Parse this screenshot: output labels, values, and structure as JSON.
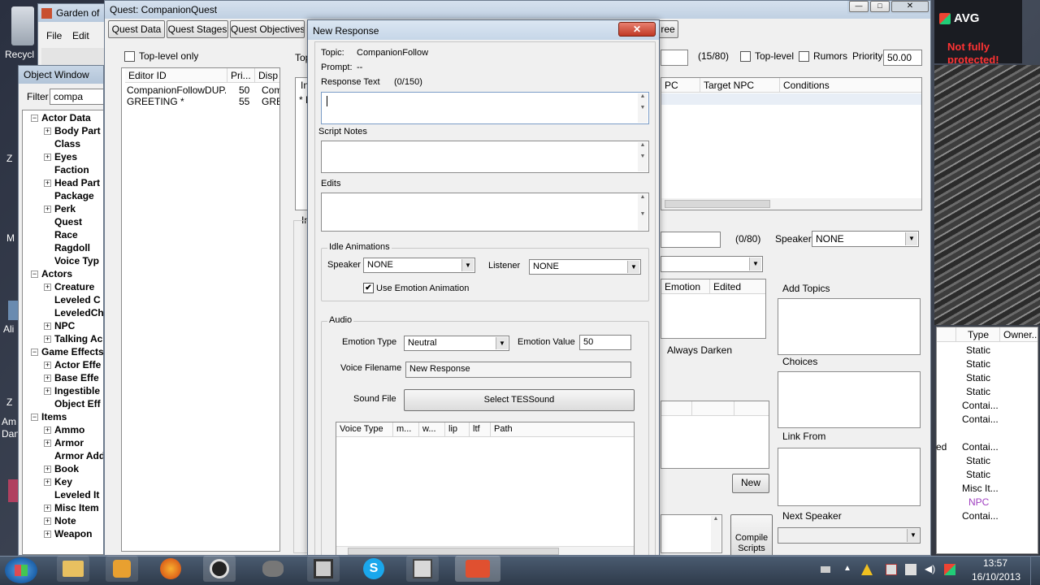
{
  "desktop": {
    "recycle_label": "Recycl",
    "frag1": "Z",
    "frag2": "M",
    "frag3": "Ali",
    "frag4": "Z",
    "frag5": "Am",
    "frag6": "Dan"
  },
  "garden_window": {
    "title": "Garden of",
    "menu_file": "File",
    "menu_edit": "Edit"
  },
  "object_window": {
    "title": "Object Window",
    "filter_label": "Filter",
    "filter_value": "compa",
    "tree": [
      {
        "label": "Actor Data",
        "level": 0,
        "pm": "−"
      },
      {
        "label": "Body Part",
        "level": 1,
        "pm": "+"
      },
      {
        "label": "Class",
        "level": 1,
        "pm": ""
      },
      {
        "label": "Eyes",
        "level": 1,
        "pm": "+"
      },
      {
        "label": "Faction",
        "level": 1,
        "pm": ""
      },
      {
        "label": "Head Part",
        "level": 1,
        "pm": "+"
      },
      {
        "label": "Package",
        "level": 1,
        "pm": ""
      },
      {
        "label": "Perk",
        "level": 1,
        "pm": "+"
      },
      {
        "label": "Quest",
        "level": 1,
        "pm": ""
      },
      {
        "label": "Race",
        "level": 1,
        "pm": ""
      },
      {
        "label": "Ragdoll",
        "level": 1,
        "pm": ""
      },
      {
        "label": "Voice Typ",
        "level": 1,
        "pm": ""
      },
      {
        "label": "Actors",
        "level": 0,
        "pm": "−"
      },
      {
        "label": "Creature",
        "level": 1,
        "pm": "+"
      },
      {
        "label": "Leveled C",
        "level": 1,
        "pm": ""
      },
      {
        "label": "LeveledCh",
        "level": 1,
        "pm": ""
      },
      {
        "label": "NPC",
        "level": 1,
        "pm": "+"
      },
      {
        "label": "Talking Ac",
        "level": 1,
        "pm": "+"
      },
      {
        "label": "Game Effects",
        "level": 0,
        "pm": "−"
      },
      {
        "label": "Actor Effe",
        "level": 1,
        "pm": "+"
      },
      {
        "label": "Base Effe",
        "level": 1,
        "pm": "+"
      },
      {
        "label": "Ingestible",
        "level": 1,
        "pm": "+"
      },
      {
        "label": "Object Eff",
        "level": 1,
        "pm": ""
      },
      {
        "label": "Items",
        "level": 0,
        "pm": "−"
      },
      {
        "label": "Ammo",
        "level": 1,
        "pm": "+"
      },
      {
        "label": "Armor",
        "level": 1,
        "pm": "+"
      },
      {
        "label": "Armor Add",
        "level": 1,
        "pm": ""
      },
      {
        "label": "Book",
        "level": 1,
        "pm": "+"
      },
      {
        "label": "Key",
        "level": 1,
        "pm": "+"
      },
      {
        "label": "Leveled It",
        "level": 1,
        "pm": ""
      },
      {
        "label": "Misc Item",
        "level": 1,
        "pm": "+"
      },
      {
        "label": "Note",
        "level": 1,
        "pm": "+"
      },
      {
        "label": "Weapon",
        "level": 1,
        "pm": "+"
      }
    ]
  },
  "quest_window": {
    "title": "Quest: CompanionQuest",
    "tabs": [
      "Quest Data",
      "Quest Stages",
      "Quest Objectives",
      "ree"
    ],
    "top_level_only": "Top-level only",
    "topic_columns": [
      "Editor ID",
      "Pri...",
      "Disp"
    ],
    "topics": [
      {
        "id": "CompanionFollowDUP...",
        "pri": "50",
        "disp": "Com"
      },
      {
        "id": "GREETING *",
        "pri": "55",
        "disp": "GRE"
      }
    ],
    "frag_top": "Top",
    "frag_in": "In",
    "frag_in2": "In",
    "frag_star": "* E",
    "count_label": "(15/80)",
    "toplevel_label": "Top-level",
    "rumors_label": "Rumors",
    "priority_label": "Priority",
    "priority_value": "50.00",
    "info_columns": [
      "PC",
      "Target NPC",
      "Conditions"
    ],
    "count2_label": "(0/80)",
    "speaker_label": "Speaker",
    "speaker_value": "NONE",
    "emotion_cols": [
      "Emotion",
      "Edited"
    ],
    "always_darken": "Always Darken",
    "add_topics": "Add Topics",
    "choices": "Choices",
    "link_from": "Link From",
    "next_speaker": "Next Speaker",
    "new_button": "New",
    "compile_button": "Compile Scripts",
    "ed_frag": "ed",
    "type_col": "Type",
    "owner_col": "Owner...",
    "types": [
      "Static",
      "Static",
      "Static",
      "Static",
      "Contai...",
      "Contai...",
      "Contai...",
      "Static",
      "Static",
      "Misc It...",
      "NPC",
      "Contai..."
    ]
  },
  "dialog": {
    "title": "New Response",
    "topic_label": "Topic:",
    "topic_value": "CompanionFollow",
    "prompt_label": "Prompt:",
    "prompt_value": "--",
    "response_label": "Response Text",
    "response_count": "(0/150)",
    "script_notes_label": "Script Notes",
    "edits_label": "Edits",
    "idle_group": "Idle Animations",
    "speaker_label": "Speaker",
    "speaker_value": "NONE",
    "listener_label": "Listener",
    "listener_value": "NONE",
    "use_emotion": "Use Emotion Animation",
    "audio_group": "Audio",
    "emotion_type_label": "Emotion Type",
    "emotion_type_value": "Neutral",
    "emotion_value_label": "Emotion Value",
    "emotion_value": "50",
    "voice_filename_label": "Voice Filename",
    "voice_filename_value": "New Response",
    "sound_file_label": "Sound File",
    "select_sound": "Select TESSound",
    "voice_columns": [
      "Voice Type",
      "m...",
      "w...",
      "lip",
      "ltf",
      "Path"
    ]
  },
  "avg": {
    "brand": "AVG",
    "line1": "Not fully",
    "line2": "protected!"
  },
  "taskbar": {
    "time": "13:57",
    "date": "16/10/2013"
  }
}
